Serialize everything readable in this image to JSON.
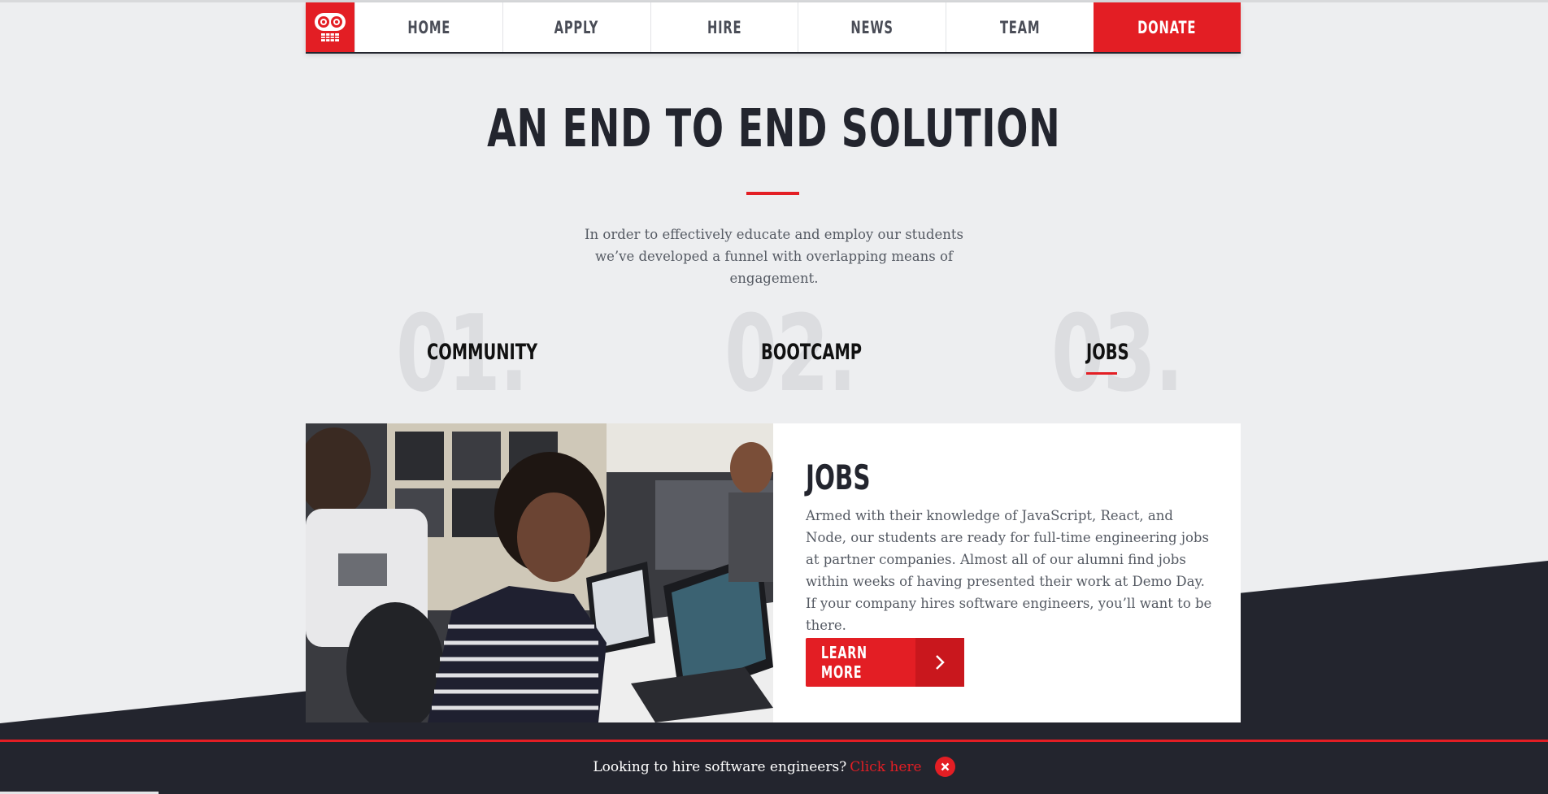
{
  "nav": {
    "logo_icon": "robot-face-icon",
    "items": [
      "HOME",
      "APPLY",
      "HIRE",
      "NEWS",
      "TEAM"
    ],
    "donate_label": "DONATE"
  },
  "hero": {
    "headline": "AN END TO END SOLUTION",
    "intro": "In order to effectively educate and employ our students we’ve developed a funnel with overlapping means of engagement."
  },
  "steps": [
    {
      "number": "01.",
      "label": "COMMUNITY"
    },
    {
      "number": "02.",
      "label": "BOOTCAMP"
    },
    {
      "number": "03.",
      "label": "JOBS"
    }
  ],
  "active_step": "JOBS",
  "card": {
    "title": "JOBS",
    "body": "Armed with their knowledge of JavaScript, React, and Node, our students are ready for full-time engineering jobs at partner companies. Almost all of our alumni find jobs within weeks of having presented their work at Demo Day. If your company hires software engineers, you’ll want to be there.",
    "button_label": "LEARN MORE",
    "button_icon": "chevron-right-icon"
  },
  "banner": {
    "text": "Looking to hire software engineers?",
    "link": "Click here",
    "close_icon": "close-circle-icon"
  },
  "colors": {
    "brand_red": "#e31e24",
    "dark": "#23252e",
    "background": "#edeef0"
  }
}
